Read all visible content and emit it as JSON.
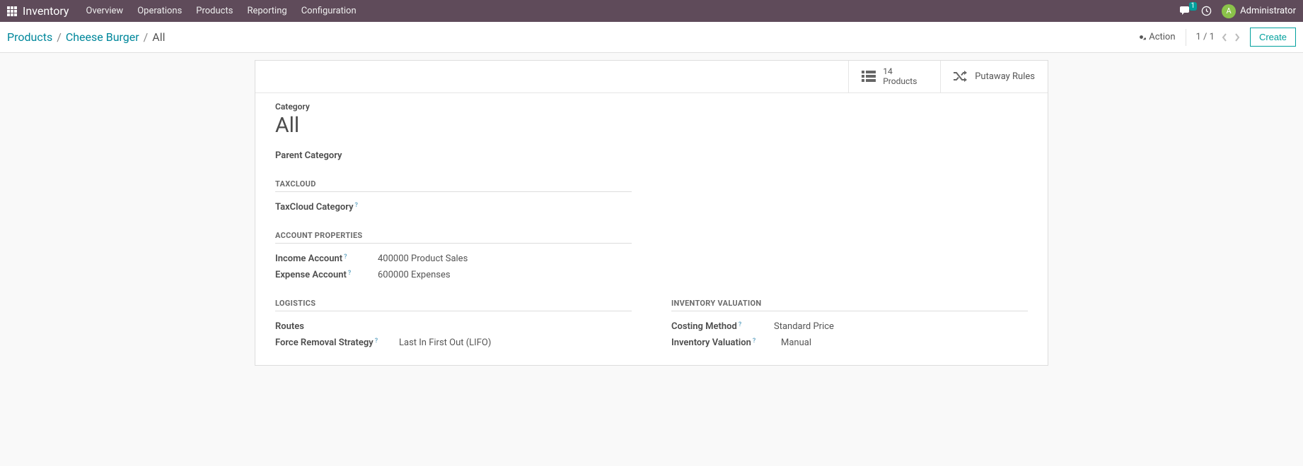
{
  "navbar": {
    "app_name": "Inventory",
    "menu": [
      "Overview",
      "Operations",
      "Products",
      "Reporting",
      "Configuration"
    ],
    "chat_count": "1",
    "user_initial": "A",
    "user_name": "Administrator"
  },
  "breadcrumb": {
    "items": [
      "Products",
      "Cheese Burger"
    ],
    "current": "All"
  },
  "actions": {
    "action_label": "Action",
    "pager": "1 / 1",
    "create_label": "Create"
  },
  "stat_buttons": {
    "products_count": "14",
    "products_label": "Products",
    "putaway_label": "Putaway Rules"
  },
  "form": {
    "category_label": "Category",
    "category_value": "All",
    "parent_category_label": "Parent Category",
    "parent_category_value": "",
    "taxcloud_header": "TAXCLOUD",
    "taxcloud_category_label": "TaxCloud Category",
    "taxcloud_category_value": "",
    "account_header": "ACCOUNT PROPERTIES",
    "income_account_label": "Income Account",
    "income_account_value": "400000 Product Sales",
    "expense_account_label": "Expense Account",
    "expense_account_value": "600000 Expenses",
    "logistics_header": "LOGISTICS",
    "routes_label": "Routes",
    "routes_value": "",
    "force_removal_label": "Force Removal Strategy",
    "force_removal_value": "Last In First Out (LIFO)",
    "inventory_valuation_header": "INVENTORY VALUATION",
    "costing_method_label": "Costing Method",
    "costing_method_value": "Standard Price",
    "inventory_valuation_label": "Inventory Valuation",
    "inventory_valuation_value": "Manual"
  }
}
